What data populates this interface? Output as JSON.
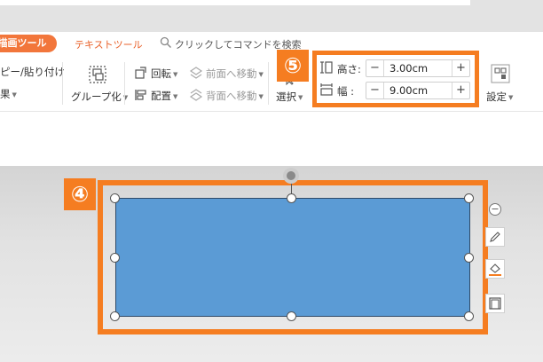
{
  "tabs": {
    "drawing_tools": "描画ツール",
    "text_tools": "テキストツール"
  },
  "search": {
    "text": "クリックしてコマンドを検索"
  },
  "ribbon": {
    "paste": "ピー/貼り付け",
    "effects": "果",
    "group": "グループ化",
    "rotate": "回転",
    "arrange": "配置",
    "bring_forward": "前面へ移動",
    "send_backward": "背面へ移動",
    "select": "選択",
    "settings": "設定"
  },
  "size": {
    "height_label": "高さ:",
    "width_label": "幅 :",
    "height_value": "3.00cm",
    "width_value": "9.00cm",
    "minus": "−",
    "plus": "+"
  },
  "badges": {
    "five": "⑤",
    "four": "④"
  },
  "colors": {
    "accent": "#f57d21",
    "tab_active": "#f2763b",
    "text_tools_tab": "#e9622b",
    "shape_fill": "#5b9bd5",
    "shape_border": "#2f4a68"
  },
  "icons": {
    "search": "search-icon",
    "group": "group-icon",
    "rotate": "rotate-icon",
    "arrange": "align-icon",
    "bring_forward": "bring-forward-icon",
    "send_backward": "send-backward-icon",
    "select": "select-cursor-icon",
    "settings": "settings-icon",
    "height": "height-icon",
    "width": "width-icon",
    "pen": "pen-icon",
    "fill": "fill-bucket-icon",
    "layout": "frame-icon",
    "collapse": "minus-icon"
  }
}
